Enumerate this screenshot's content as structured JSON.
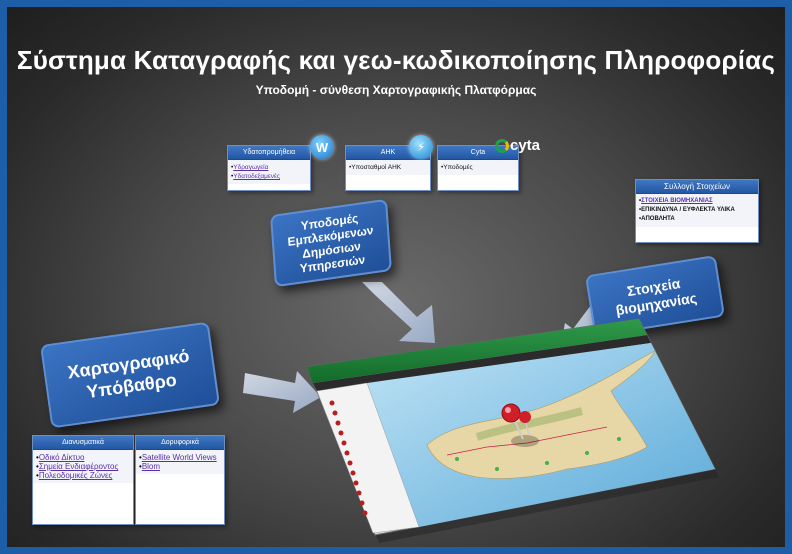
{
  "title": "Σύστημα Καταγραφής και γεω-κωδικοποίησης Πληροφορίας",
  "subtitle": "Υποδομή - σύνθεση Χαρτογραφικής  Πλατφόρμας",
  "top_cards": [
    {
      "header": "Υδατοπρομήθεια",
      "items": [
        "Υδραγωγεία",
        "Υδατοδεξαμενές"
      ],
      "linked": true
    },
    {
      "header": "ΑΗΚ",
      "items": [
        "Υποσταθμοί ΑΗΚ"
      ],
      "linked": false
    },
    {
      "header": "Cyta",
      "items": [
        "Υποδομές"
      ],
      "linked": false
    }
  ],
  "cyta_logo": "cyta",
  "collection": {
    "header": "Συλλογή Στοιχείων",
    "items": [
      "ΣΤΟΙΧΕΙΑ  ΒΙΟΜΗΧΑΝΙΑΣ",
      "ΕΠΙΚΙΝΔΥΝΑ / ΕΥΦΛΕΚΤΑ ΥΛΙΚΑ",
      "ΑΠΟΒΛΗΤΑ"
    ]
  },
  "boxes": {
    "utilities": "Υποδομές Εμπλεκόμενων Δημόσιων Υπηρεσιών",
    "industry": "Στοιχεία βιομηχανίας",
    "basemap": "Χαρτογραφικό Υπόβαθρο"
  },
  "bottom_cards": [
    {
      "header": "Διανυσματικά",
      "items": [
        "Οδικό Δίκτυο",
        "Σημεία Ενδιαφέροντος",
        "Πολεοδομικές Ζώνες"
      ]
    },
    {
      "header": "Δορυφορικά",
      "items": [
        "Satellite World Views",
        "Blom"
      ]
    }
  ],
  "colors": {
    "frame": "#1c5fa8",
    "box": "#2a5ca8",
    "card_header": "#2f66b5",
    "link": "#5a2fa8"
  },
  "icons": [
    "water-w-icon",
    "power-lightning-icon",
    "cyta-logo",
    "map-pin-icon"
  ]
}
